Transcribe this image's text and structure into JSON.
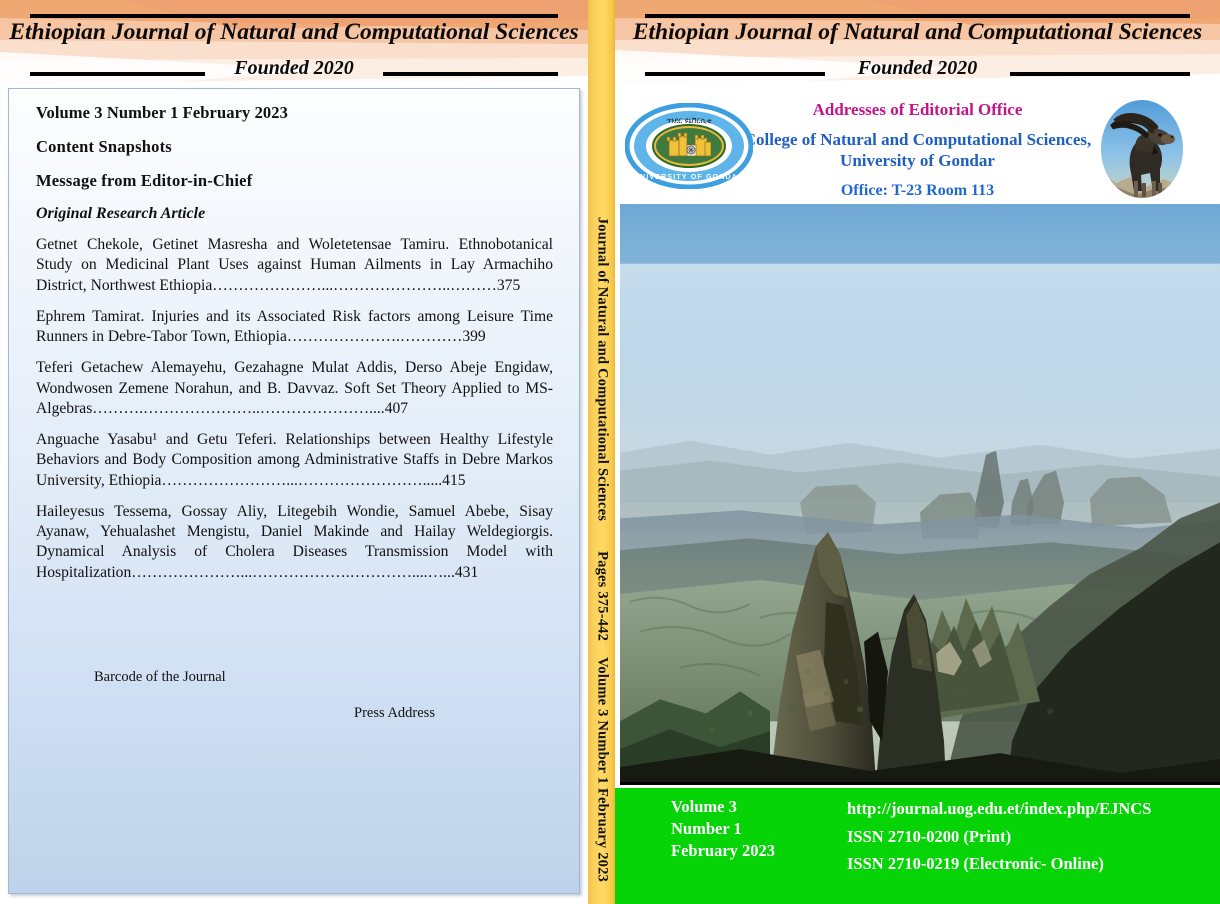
{
  "journal": {
    "title": "Ethiopian Journal of Natural and Computational Sciences",
    "founded": "Founded 2020"
  },
  "back_cover": {
    "volume_line": "Volume 3   Number 1    February 2023",
    "content_snapshots": "Content Snapshots",
    "message_editor": "Message from Editor-in-Chief",
    "section_heading": "Original Research Article",
    "entries": [
      {
        "text": "Getnet Chekole, Getinet Masresha and Woletetensae Tamiru. Ethnobotanical Study on Medicinal Plant Uses against Human Ailments in Lay Armachiho District, Northwest Ethiopia",
        "dots": "…………………...…………………..………",
        "page": "375"
      },
      {
        "text": "Ephrem Tamirat. Injuries and its Associated Risk factors among Leisure Time Runners in Debre-Tabor Town, Ethiopia",
        "dots": "………………….…………",
        "page": "399"
      },
      {
        "text": "Teferi Getachew Alemayehu, Gezahagne Mulat Addis, Derso Abeje Engidaw, Wondwosen Zemene Norahun, and B. Davvaz. Soft Set Theory Applied to MS-Algebras",
        "dots": "……….…………………..…………………....",
        "page": "407"
      },
      {
        "text": "Anguache Yasabu¹ and Getu Teferi. Relationships between Healthy Lifestyle Behaviors and Body Composition among Administrative Staffs in Debre Markos University, Ethiopia",
        "dots": "……………………...…………………….....",
        "page": "415"
      },
      {
        "text": "Haileyesus Tessema, Gossay Aliy, Litegebih Wondie, Samuel Abebe, Sisay Ayanaw, Yehualashet Mengistu, Daniel Makinde and Hailay Weldegiorgis. Dynamical Analysis of Cholera Diseases Transmission Model with Hospitalization",
        "dots": "…………………...……………….…………....…...",
        "page": "431"
      }
    ],
    "barcode_note": "Barcode  of the Journal",
    "press_note": "Press Address"
  },
  "spine": {
    "journal_name": "Journal of Natural  and  Computational Sciences",
    "pages": "Pages 375-442",
    "issue": "Volume  3  Number 1 February 2023"
  },
  "front_cover": {
    "address_title": "Addresses of Editorial Office",
    "college": "College of Natural and Computational Sciences,",
    "university": "University of Gondar",
    "office": "Office: T-23 Room 113",
    "seal_name": "university-of-gondar-seal",
    "seal_text_amharic": "ጎንደር ዩኒቨርሲቲ",
    "seal_text_english": "UNIVERSITY OF GONDAR",
    "ibex_name": "walia-ibex-photo",
    "landscape_name": "simien-mountains-landscape-photo",
    "footer": {
      "volume": "Volume  3",
      "number": "Number  1",
      "date": "February 2023",
      "url": "http://journal.uog.edu.et/index.php/EJNCS",
      "issn_print": "ISSN 2710-0200 (Print)",
      "issn_online": "ISSN 2710-0219 (Electronic- Online)"
    }
  },
  "colors": {
    "spine_yellow": "#ffd964",
    "footer_green": "#07d407",
    "address_magenta": "#c2148c",
    "address_blue": "#1f5fc0",
    "panel_blue": "#bed2e9",
    "header_peach": "#f2b385"
  }
}
